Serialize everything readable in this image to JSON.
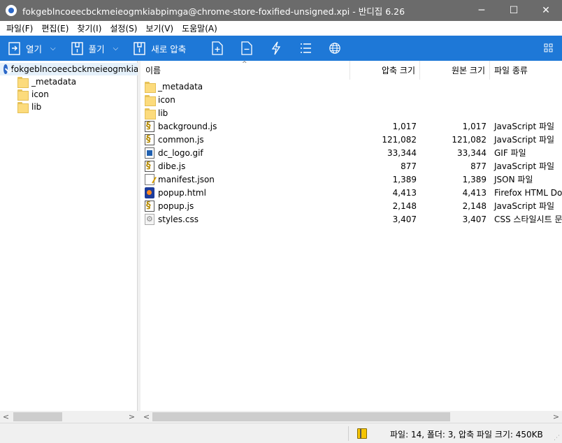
{
  "window": {
    "title": "fokgeblncoeecbckmeieogmkiabpimga@chrome-store-foxified-unsigned.xpi - 반디집 6.26",
    "minimize": "─",
    "maximize": "☐",
    "close": "✕"
  },
  "menu": [
    "파일(F)",
    "편집(E)",
    "찾기(I)",
    "설정(S)",
    "보기(V)",
    "도움말(A)"
  ],
  "toolbar": {
    "open_label": "열기",
    "extract_label": "풀기",
    "new_archive_label": "새로 압축",
    "caret": "⌵"
  },
  "tree": {
    "root": "fokgeblncoeecbckmeieogmkiabpimga@chrome-store-foxified-unsigned.xpi",
    "children": [
      "_metadata",
      "icon",
      "lib"
    ]
  },
  "columns": {
    "name": "이름",
    "compressed": "압축 크기",
    "original": "원본 크기",
    "type": "파일 종류",
    "sort_indicator": "^"
  },
  "files": [
    {
      "name": "_metadata",
      "compressed": "",
      "original": "",
      "type": "",
      "icon": "folder-icon"
    },
    {
      "name": "icon",
      "compressed": "",
      "original": "",
      "type": "",
      "icon": "folder-icon"
    },
    {
      "name": "lib",
      "compressed": "",
      "original": "",
      "type": "",
      "icon": "folder-icon"
    },
    {
      "name": "background.js",
      "compressed": "1,017",
      "original": "1,017",
      "type": "JavaScript 파일",
      "icon": "js-file-icon"
    },
    {
      "name": "common.js",
      "compressed": "121,082",
      "original": "121,082",
      "type": "JavaScript 파일",
      "icon": "js-file-icon"
    },
    {
      "name": "dc_logo.gif",
      "compressed": "33,344",
      "original": "33,344",
      "type": "GIF 파일",
      "icon": "gif-file-icon"
    },
    {
      "name": "dibe.js",
      "compressed": "877",
      "original": "877",
      "type": "JavaScript 파일",
      "icon": "js-file-icon"
    },
    {
      "name": "manifest.json",
      "compressed": "1,389",
      "original": "1,389",
      "type": "JSON 파일",
      "icon": "json-file-icon"
    },
    {
      "name": "popup.html",
      "compressed": "4,413",
      "original": "4,413",
      "type": "Firefox HTML Document",
      "icon": "html-file-icon"
    },
    {
      "name": "popup.js",
      "compressed": "2,148",
      "original": "2,148",
      "type": "JavaScript 파일",
      "icon": "js-file-icon"
    },
    {
      "name": "styles.css",
      "compressed": "3,407",
      "original": "3,407",
      "type": "CSS 스타일시트 문서",
      "icon": "css-file-icon"
    }
  ],
  "scroll": {
    "left_arrow": "<",
    "right_arrow": ">"
  },
  "status": {
    "text": "파일: 14, 폴더: 3, 압축 파일 크기: 450KB"
  },
  "colors": {
    "toolbar_bg": "#1e78d7",
    "titlebar_bg": "#6b6b6b",
    "selection": "#e5f1fb"
  }
}
